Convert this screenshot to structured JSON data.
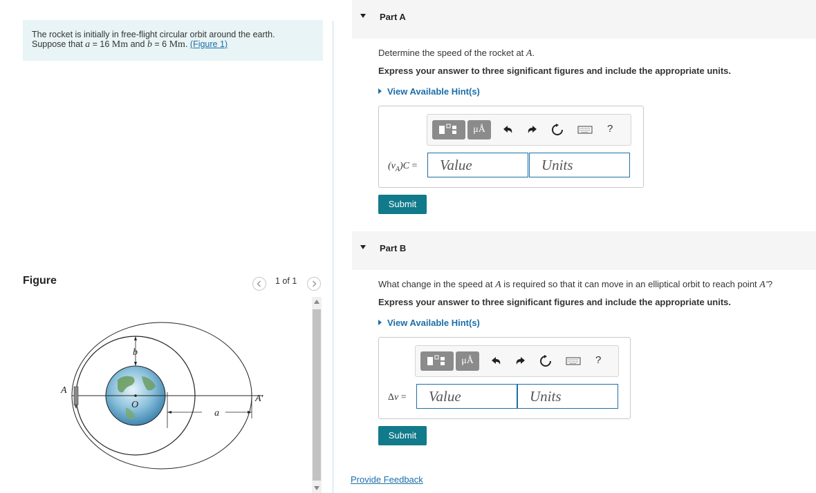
{
  "problem": {
    "line1": "The rocket is initially in free-flight circular orbit around the earth.",
    "line2_prefix": "Suppose that ",
    "a_var": "a",
    "a_eq": " = 16 ",
    "a_unit": "Mm",
    "mid": " and ",
    "b_var": "b",
    "b_eq": " = 6 ",
    "b_unit": "Mm",
    "period": ". ",
    "figure_link": "(Figure 1)"
  },
  "figure": {
    "title": "Figure",
    "pager": "1 of 1",
    "labels": {
      "A": "A",
      "b": "b",
      "O": "O",
      "A_prime": "A′",
      "a": "a"
    }
  },
  "partA": {
    "title": "Part A",
    "question_prefix": "Determine the speed of the rocket at ",
    "question_var": "A",
    "question_suffix": ".",
    "instruction": "Express your answer to three significant figures and include the appropriate units.",
    "hint": "View Available Hint(s)",
    "label": "(vₐ)c =",
    "label_v": "(v",
    "label_sub": "A",
    "label_c": ")C",
    "label_eq": " =",
    "value_placeholder": "Value",
    "units_placeholder": "Units",
    "submit": "Submit"
  },
  "partB": {
    "title": "Part B",
    "question_prefix": "What change in the speed at ",
    "question_var": "A",
    "question_mid": " is required so that it can move in an elliptical orbit to reach point ",
    "question_var2": "A′",
    "question_suffix": "?",
    "instruction": "Express your answer to three significant figures and include the appropriate units.",
    "hint": "View Available Hint(s)",
    "label_delta": "Δ",
    "label_v": "v",
    "label_eq": " =",
    "value_placeholder": "Value",
    "units_placeholder": "Units",
    "submit": "Submit"
  },
  "toolbar": {
    "mu_label": "μÅ",
    "help": "?"
  },
  "feedback": "Provide Feedback"
}
